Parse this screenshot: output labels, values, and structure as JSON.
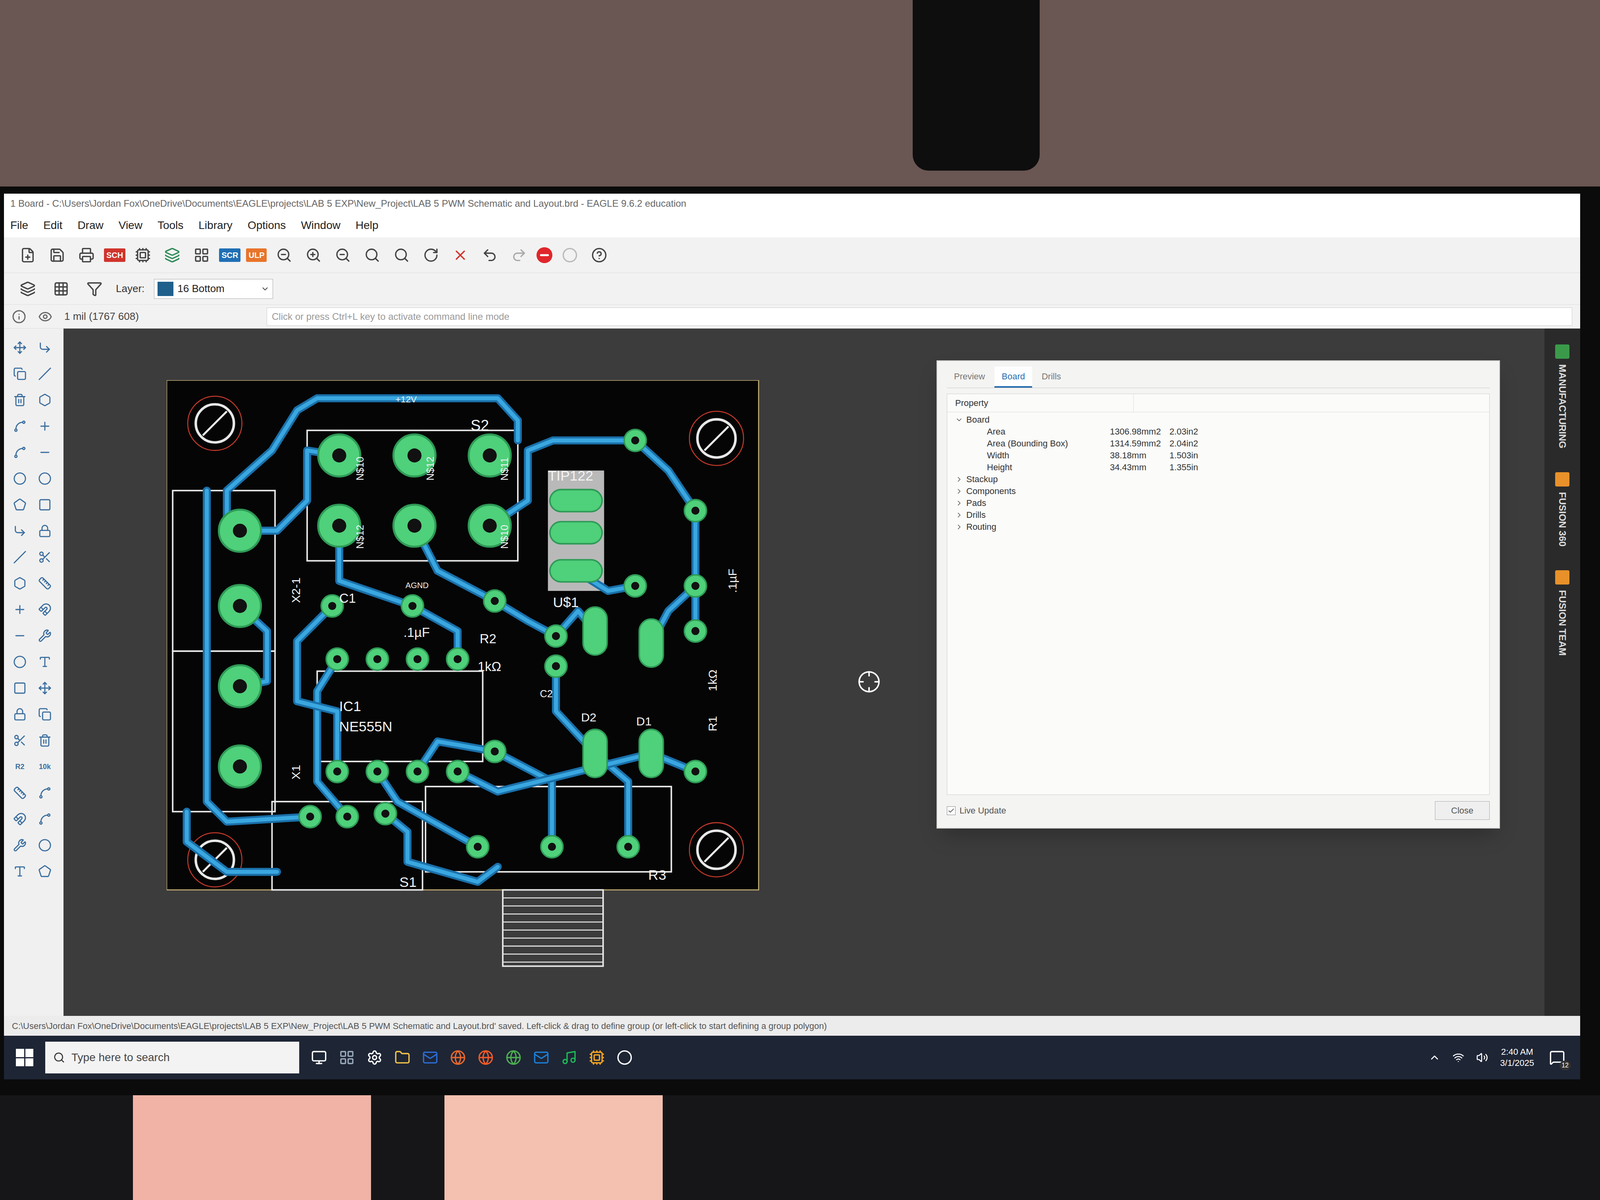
{
  "window": {
    "title": "1 Board - C:\\Users\\Jordan Fox\\OneDrive\\Documents\\EAGLE\\projects\\LAB 5 EXP\\New_Project\\LAB 5 PWM Schematic and Layout.brd - EAGLE 9.6.2 education"
  },
  "menu": [
    "File",
    "Edit",
    "Draw",
    "View",
    "Tools",
    "Library",
    "Options",
    "Window",
    "Help"
  ],
  "toolbar": {
    "text_buttons": [
      {
        "label": "SCH",
        "color": "#d0342c"
      },
      {
        "label": "SCR",
        "color": "#1f6fb5"
      },
      {
        "label": "ULP",
        "color": "#e8742a"
      }
    ]
  },
  "layer": {
    "label": "Layer:",
    "value": "16 Bottom",
    "color": "#1f5f8b"
  },
  "coordinates": "1 mil (1767 608)",
  "command_placeholder": "Click or press Ctrl+L key to activate command line mode",
  "palette_labels": [
    "R2",
    "10k"
  ],
  "pcb": {
    "labels": [
      "+12V",
      "S2",
      "N$10",
      "N$12",
      "N$11",
      "N$12",
      "N$10",
      "TIP122",
      "U$1",
      "C1",
      ".1µF",
      "R2",
      "1kΩ",
      "IC1",
      "NE555N",
      "D2",
      "D1",
      "R1",
      "1kΩ",
      ".1µF",
      "C2",
      "X2-1",
      "X1",
      "S1",
      "R3",
      "AGND"
    ]
  },
  "dialog": {
    "tabs": [
      {
        "label": "Preview",
        "selected": false
      },
      {
        "label": "Board",
        "selected": true
      },
      {
        "label": "Drills",
        "selected": false
      }
    ],
    "header": "Property",
    "tree": [
      {
        "label": "Board",
        "expanded": true,
        "children": [
          {
            "label": "Area",
            "metric": "1306.98mm2",
            "imperial": "2.03in2"
          },
          {
            "label": "Area (Bounding Box)",
            "metric": "1314.59mm2",
            "imperial": "2.04in2"
          },
          {
            "label": "Width",
            "metric": "38.18mm",
            "imperial": "1.503in"
          },
          {
            "label": "Height",
            "metric": "34.43mm",
            "imperial": "1.355in"
          }
        ]
      },
      {
        "label": "Stackup",
        "expanded": false,
        "children": []
      },
      {
        "label": "Components",
        "expanded": false,
        "children": []
      },
      {
        "label": "Pads",
        "expanded": false,
        "children": []
      },
      {
        "label": "Drills",
        "expanded": false,
        "children": []
      },
      {
        "label": "Routing",
        "expanded": false,
        "children": []
      }
    ],
    "live_update": {
      "label": "Live Update",
      "checked": true
    },
    "close": "Close"
  },
  "side_panels": [
    "MANUFACTURING",
    "FUSION 360",
    "FUSION TEAM"
  ],
  "status": "C:\\Users\\Jordan Fox\\OneDrive\\Documents\\EAGLE\\projects\\LAB 5 EXP\\New_Project\\LAB 5 PWM Schematic and Layout.brd' saved. Left-click & drag to define group (or left-click to start defining a group polygon)",
  "taskbar": {
    "search_placeholder": "Type here to search",
    "time": "2:40 AM",
    "date": "3/1/2025",
    "notifications": "12"
  }
}
